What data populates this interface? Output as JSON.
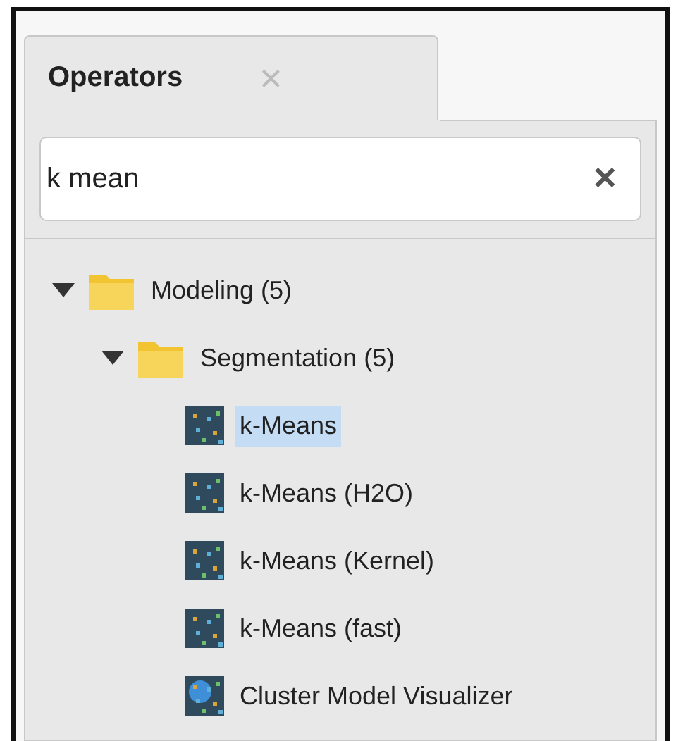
{
  "tabs": [
    {
      "label": "Operators",
      "selected": true,
      "close": "×"
    }
  ],
  "search": {
    "value": "k mean",
    "clear": "✕"
  },
  "tree": [
    {
      "label": "Modeling (5)",
      "kind": "folder",
      "expanded": true,
      "selected": false,
      "children": [
        {
          "label": "Segmentation (5)",
          "kind": "folder",
          "expanded": true,
          "selected": false,
          "children": [
            {
              "label": "k-Means",
              "kind": "operator",
              "selected": true
            },
            {
              "label": "k-Means (H2O)",
              "kind": "operator",
              "selected": false
            },
            {
              "label": "k-Means (Kernel)",
              "kind": "operator",
              "selected": false
            },
            {
              "label": "k-Means (fast)",
              "kind": "operator",
              "selected": false
            },
            {
              "label": "Cluster Model Visualizer",
              "kind": "visualizer",
              "selected": false
            }
          ]
        }
      ]
    }
  ]
}
